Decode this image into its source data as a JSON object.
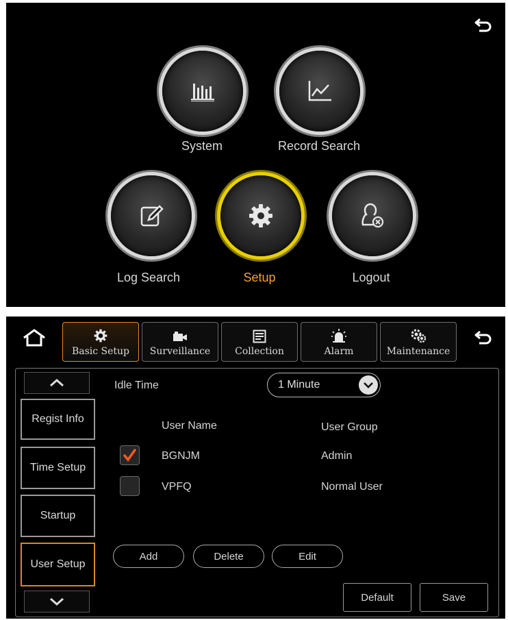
{
  "main_menu": {
    "items": [
      {
        "label": "System",
        "icon": "bar-chart-icon"
      },
      {
        "label": "Record Search",
        "icon": "line-chart-icon"
      },
      {
        "label": "Log Search",
        "icon": "edit-icon"
      },
      {
        "label": "Setup",
        "icon": "gear-icon",
        "active": true
      },
      {
        "label": "Logout",
        "icon": "user-remove-icon"
      }
    ]
  },
  "tabs": [
    {
      "label": "Basic Setup",
      "icon": "gear-icon",
      "active": true
    },
    {
      "label": "Surveillance",
      "icon": "camera-icon"
    },
    {
      "label": "Collection",
      "icon": "list-icon"
    },
    {
      "label": "Alarm",
      "icon": "siren-icon"
    },
    {
      "label": "Maintenance",
      "icon": "gears-icon"
    }
  ],
  "sidebar": {
    "items": [
      {
        "label": "Regist Info"
      },
      {
        "label": "Time Setup"
      },
      {
        "label": "Startup"
      },
      {
        "label": "User Setup",
        "active": true
      }
    ]
  },
  "idle_time": {
    "label": "Idle Time",
    "value": "1 Minute"
  },
  "users": {
    "headers": {
      "name": "User Name",
      "group": "User Group"
    },
    "rows": [
      {
        "name": "BGNJM",
        "group": "Admin",
        "checked": true
      },
      {
        "name": "VPFQ",
        "group": "Normal User",
        "checked": false
      }
    ]
  },
  "actions": {
    "add": "Add",
    "delete": "Delete",
    "edit": "Edit",
    "default": "Default",
    "save": "Save"
  },
  "colors": {
    "accent": "#f2a431",
    "active_ring": "#e7d000",
    "check_mark": "#ff5a1f"
  }
}
